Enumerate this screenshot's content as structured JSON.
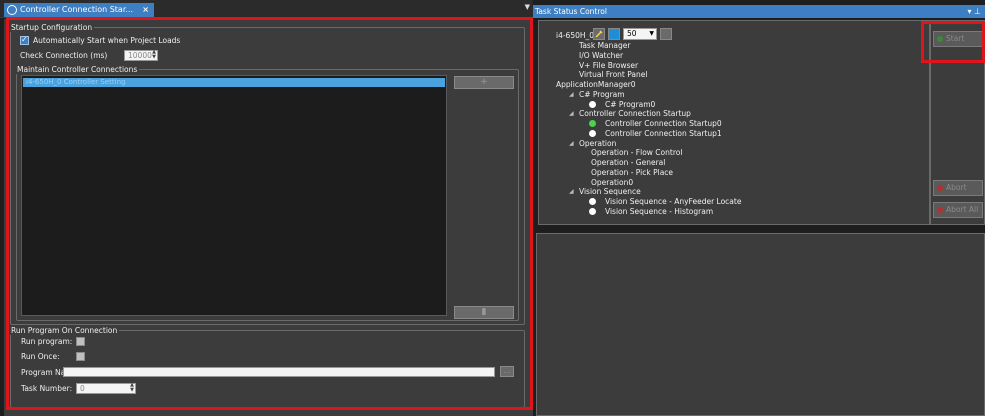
{
  "left_tab": {
    "title": "Controller Connection Star...",
    "close": "×"
  },
  "left_dropdown": "▼",
  "startup": {
    "legend": "Startup Configuration",
    "auto_start_label": "Automatically Start when Project Loads",
    "auto_start_checked": true,
    "check_connection_label": "Check Connection (ms)",
    "check_connection_value": "10000"
  },
  "maintain": {
    "legend": "Maintain Controller Connections",
    "selected_item": "i4-650H_0 Controller Setting",
    "add_label": "+",
    "remove_label": "▮"
  },
  "run_program": {
    "legend": "Run Program On Connection",
    "run_program_label": "Run program:",
    "run_once_label": "Run Once:",
    "program_name_label": "Program Name:",
    "program_name_value": "",
    "browse_label": "...",
    "task_number_label": "Task Number:",
    "task_number_value": "0"
  },
  "right_tab": {
    "title": "Task Status Control",
    "pin": "▾ ⊥"
  },
  "task_toolbar": {
    "robot_name": "i4-650H_0",
    "speed_value": "50"
  },
  "task_tree": [
    {
      "label": "Task Manager",
      "indent": 1,
      "dot": ""
    },
    {
      "label": "I/O Watcher",
      "indent": 1,
      "dot": ""
    },
    {
      "label": "V+ File Browser",
      "indent": 1,
      "dot": ""
    },
    {
      "label": "Virtual Front Panel",
      "indent": 1,
      "dot": ""
    },
    {
      "label": "ApplicationManager0",
      "indent": 0,
      "dot": ""
    },
    {
      "label": "C# Program",
      "indent": 1,
      "dot": "",
      "chev": true
    },
    {
      "label": "C# Program0",
      "indent": 2,
      "dot": "white"
    },
    {
      "label": "Controller Connection Startup",
      "indent": 1,
      "dot": "",
      "chev": true
    },
    {
      "label": "Controller Connection Startup0",
      "indent": 2,
      "dot": "green"
    },
    {
      "label": "Controller Connection Startup1",
      "indent": 2,
      "dot": "white"
    },
    {
      "label": "Operation",
      "indent": 1,
      "dot": "",
      "chev": true
    },
    {
      "label": "Operation - Flow Control",
      "indent": 2,
      "dot": ""
    },
    {
      "label": "Operation - General",
      "indent": 2,
      "dot": ""
    },
    {
      "label": "Operation - Pick Place",
      "indent": 2,
      "dot": ""
    },
    {
      "label": "Operation0",
      "indent": 2,
      "dot": ""
    },
    {
      "label": "Vision Sequence",
      "indent": 1,
      "dot": "",
      "chev": true
    },
    {
      "label": "Vision Sequence - AnyFeeder Locate",
      "indent": 2,
      "dot": "white"
    },
    {
      "label": "Vision Sequence - Histogram",
      "indent": 2,
      "dot": "white"
    }
  ],
  "task_buttons": {
    "start": "Start",
    "abort": "Abort",
    "abort_all": "Abort All"
  },
  "colors": {
    "accent": "#3d7fc2",
    "highlight_red": "#e0151c",
    "running_green": "#4bd24b"
  }
}
